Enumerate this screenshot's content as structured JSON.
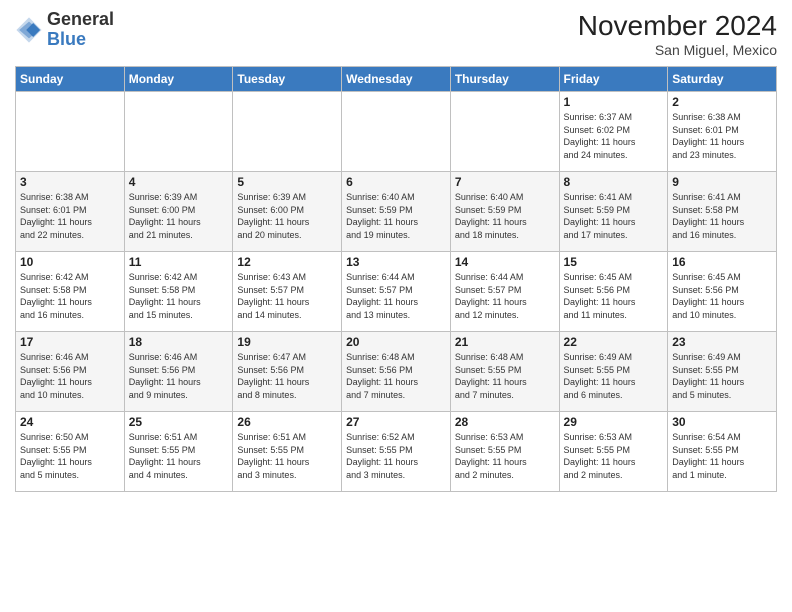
{
  "header": {
    "logo_general": "General",
    "logo_blue": "Blue",
    "month_title": "November 2024",
    "location": "San Miguel, Mexico"
  },
  "weekdays": [
    "Sunday",
    "Monday",
    "Tuesday",
    "Wednesday",
    "Thursday",
    "Friday",
    "Saturday"
  ],
  "weeks": [
    [
      {
        "day": "",
        "info": ""
      },
      {
        "day": "",
        "info": ""
      },
      {
        "day": "",
        "info": ""
      },
      {
        "day": "",
        "info": ""
      },
      {
        "day": "",
        "info": ""
      },
      {
        "day": "1",
        "info": "Sunrise: 6:37 AM\nSunset: 6:02 PM\nDaylight: 11 hours\nand 24 minutes."
      },
      {
        "day": "2",
        "info": "Sunrise: 6:38 AM\nSunset: 6:01 PM\nDaylight: 11 hours\nand 23 minutes."
      }
    ],
    [
      {
        "day": "3",
        "info": "Sunrise: 6:38 AM\nSunset: 6:01 PM\nDaylight: 11 hours\nand 22 minutes."
      },
      {
        "day": "4",
        "info": "Sunrise: 6:39 AM\nSunset: 6:00 PM\nDaylight: 11 hours\nand 21 minutes."
      },
      {
        "day": "5",
        "info": "Sunrise: 6:39 AM\nSunset: 6:00 PM\nDaylight: 11 hours\nand 20 minutes."
      },
      {
        "day": "6",
        "info": "Sunrise: 6:40 AM\nSunset: 5:59 PM\nDaylight: 11 hours\nand 19 minutes."
      },
      {
        "day": "7",
        "info": "Sunrise: 6:40 AM\nSunset: 5:59 PM\nDaylight: 11 hours\nand 18 minutes."
      },
      {
        "day": "8",
        "info": "Sunrise: 6:41 AM\nSunset: 5:59 PM\nDaylight: 11 hours\nand 17 minutes."
      },
      {
        "day": "9",
        "info": "Sunrise: 6:41 AM\nSunset: 5:58 PM\nDaylight: 11 hours\nand 16 minutes."
      }
    ],
    [
      {
        "day": "10",
        "info": "Sunrise: 6:42 AM\nSunset: 5:58 PM\nDaylight: 11 hours\nand 16 minutes."
      },
      {
        "day": "11",
        "info": "Sunrise: 6:42 AM\nSunset: 5:58 PM\nDaylight: 11 hours\nand 15 minutes."
      },
      {
        "day": "12",
        "info": "Sunrise: 6:43 AM\nSunset: 5:57 PM\nDaylight: 11 hours\nand 14 minutes."
      },
      {
        "day": "13",
        "info": "Sunrise: 6:44 AM\nSunset: 5:57 PM\nDaylight: 11 hours\nand 13 minutes."
      },
      {
        "day": "14",
        "info": "Sunrise: 6:44 AM\nSunset: 5:57 PM\nDaylight: 11 hours\nand 12 minutes."
      },
      {
        "day": "15",
        "info": "Sunrise: 6:45 AM\nSunset: 5:56 PM\nDaylight: 11 hours\nand 11 minutes."
      },
      {
        "day": "16",
        "info": "Sunrise: 6:45 AM\nSunset: 5:56 PM\nDaylight: 11 hours\nand 10 minutes."
      }
    ],
    [
      {
        "day": "17",
        "info": "Sunrise: 6:46 AM\nSunset: 5:56 PM\nDaylight: 11 hours\nand 10 minutes."
      },
      {
        "day": "18",
        "info": "Sunrise: 6:46 AM\nSunset: 5:56 PM\nDaylight: 11 hours\nand 9 minutes."
      },
      {
        "day": "19",
        "info": "Sunrise: 6:47 AM\nSunset: 5:56 PM\nDaylight: 11 hours\nand 8 minutes."
      },
      {
        "day": "20",
        "info": "Sunrise: 6:48 AM\nSunset: 5:56 PM\nDaylight: 11 hours\nand 7 minutes."
      },
      {
        "day": "21",
        "info": "Sunrise: 6:48 AM\nSunset: 5:55 PM\nDaylight: 11 hours\nand 7 minutes."
      },
      {
        "day": "22",
        "info": "Sunrise: 6:49 AM\nSunset: 5:55 PM\nDaylight: 11 hours\nand 6 minutes."
      },
      {
        "day": "23",
        "info": "Sunrise: 6:49 AM\nSunset: 5:55 PM\nDaylight: 11 hours\nand 5 minutes."
      }
    ],
    [
      {
        "day": "24",
        "info": "Sunrise: 6:50 AM\nSunset: 5:55 PM\nDaylight: 11 hours\nand 5 minutes."
      },
      {
        "day": "25",
        "info": "Sunrise: 6:51 AM\nSunset: 5:55 PM\nDaylight: 11 hours\nand 4 minutes."
      },
      {
        "day": "26",
        "info": "Sunrise: 6:51 AM\nSunset: 5:55 PM\nDaylight: 11 hours\nand 3 minutes."
      },
      {
        "day": "27",
        "info": "Sunrise: 6:52 AM\nSunset: 5:55 PM\nDaylight: 11 hours\nand 3 minutes."
      },
      {
        "day": "28",
        "info": "Sunrise: 6:53 AM\nSunset: 5:55 PM\nDaylight: 11 hours\nand 2 minutes."
      },
      {
        "day": "29",
        "info": "Sunrise: 6:53 AM\nSunset: 5:55 PM\nDaylight: 11 hours\nand 2 minutes."
      },
      {
        "day": "30",
        "info": "Sunrise: 6:54 AM\nSunset: 5:55 PM\nDaylight: 11 hours\nand 1 minute."
      }
    ]
  ]
}
